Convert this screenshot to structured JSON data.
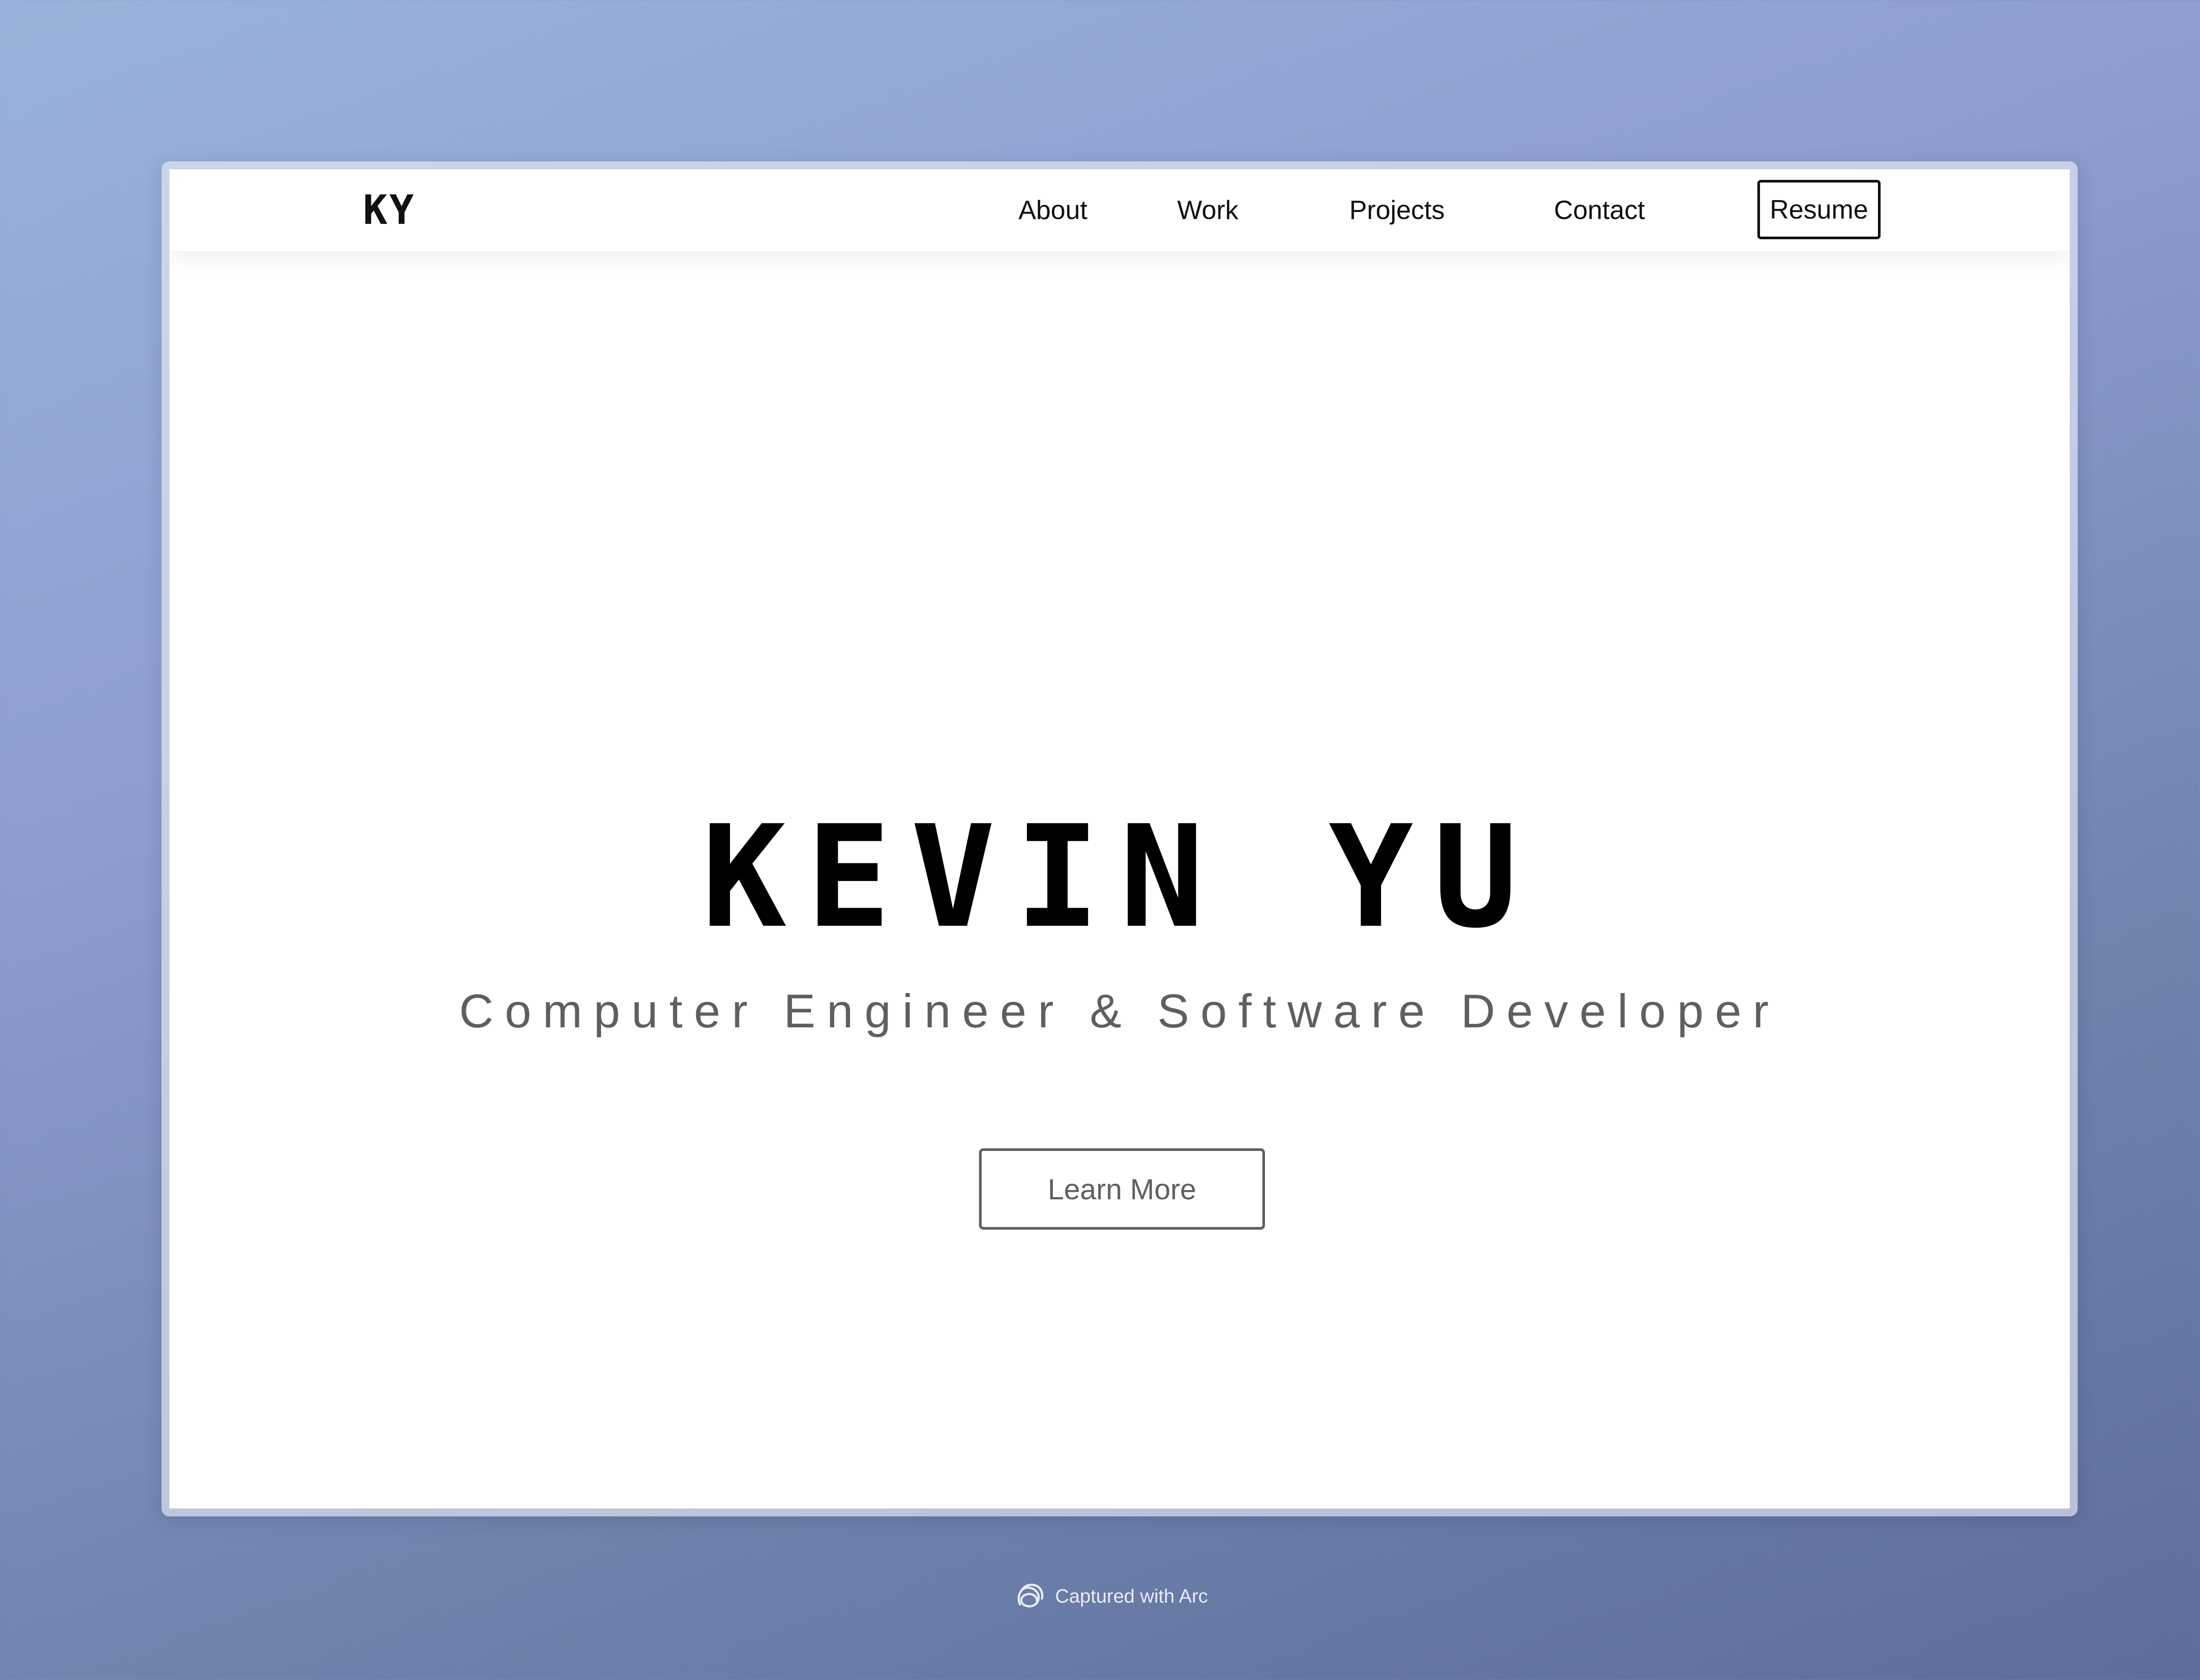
{
  "navbar": {
    "logo": "KY",
    "items": [
      {
        "label": "About"
      },
      {
        "label": "Work"
      },
      {
        "label": "Projects"
      },
      {
        "label": "Contact"
      }
    ],
    "resume_label": "Resume"
  },
  "hero": {
    "title": "KEVIN YU",
    "subtitle": "Computer Engineer & Software Developer",
    "cta_label": "Learn More"
  },
  "footer": {
    "capture_label": "Captured with Arc",
    "icon": "arc-logo-icon"
  },
  "colors": {
    "page_background": "#ffffff",
    "text_primary": "#111111",
    "text_secondary": "#5f5f5f",
    "gradient_top_left": "#98b3db",
    "gradient_bottom_right": "#5f6c9c"
  }
}
